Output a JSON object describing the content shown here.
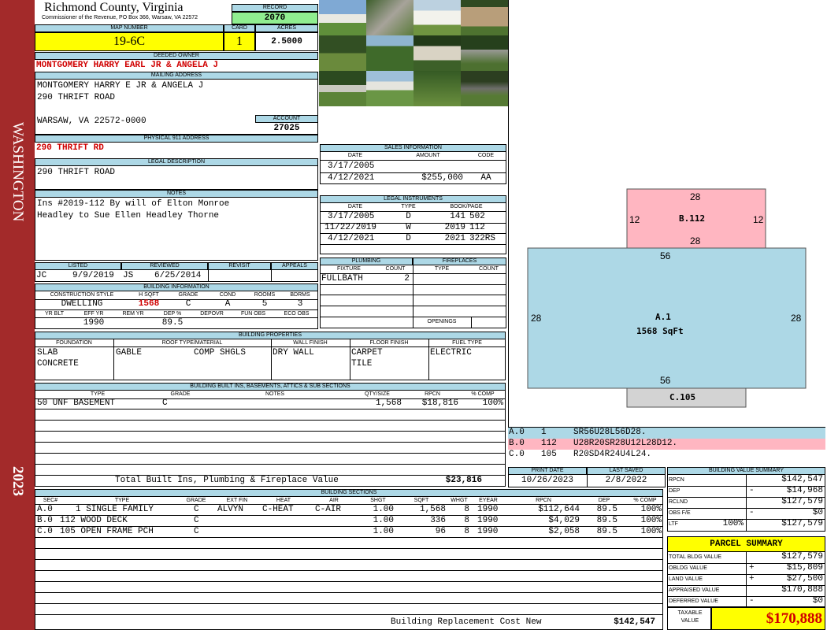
{
  "sidebar": {
    "district": "WASHINGTON",
    "year": "2023"
  },
  "header": {
    "county": "Richmond County, Virginia",
    "commissioner": "Commissioner of the Revenue, PO Box 366, Warsaw, VA 22572",
    "record_label": "RECORD",
    "record": "2070",
    "map_label": "MAP NUMBER",
    "map": "19-6C",
    "card_label": "CARD",
    "card": "1",
    "acres_label": "ACRES",
    "acres": "2.5000"
  },
  "owner": {
    "deeded_label": "DEEDED OWNER",
    "deeded": "MONTGOMERY HARRY EARL JR & ANGELA J",
    "mailing_label": "MAILING ADDRESS",
    "mailing": [
      "MONTGOMERY HARRY E JR & ANGELA J",
      "290 THRIFT ROAD",
      "WARSAW, VA 22572-0000"
    ],
    "account_label": "ACCOUNT",
    "account": "27025",
    "physical_label": "PHYSICAL 911 ADDRESS",
    "physical": "290 THRIFT RD",
    "legal_label": "LEGAL DESCRIPTION",
    "legal": "290 THRIFT ROAD",
    "notes_label": "NOTES",
    "notes": [
      "Ins #2019-112 By will of Elton Monroe",
      "Headley to Sue Ellen Headley Thorne"
    ]
  },
  "review": {
    "listed_label": "LISTED",
    "reviewed_label": "REVIEWED",
    "revisit_label": "REVISIT",
    "appeals_label": "APPEALS",
    "listed_by": "JC",
    "listed_date": "9/9/2019",
    "reviewed_by": "JS",
    "reviewed_date": "6/25/2014"
  },
  "building_info": {
    "label": "BUILDING INFORMATION",
    "headers": [
      "CONSTRUCTION STYLE",
      "H SQFT",
      "GRADE",
      "COND",
      "ROOMS",
      "BDRMS"
    ],
    "values": [
      "DWELLING",
      "1568",
      "C",
      "A",
      "5",
      "3"
    ],
    "headers2": [
      "YR BLT",
      "EFF YR",
      "REM YR",
      "DEP %",
      "DEPOVR",
      "FUN OBS",
      "ECO OBS"
    ],
    "values2": [
      "",
      "1990",
      "",
      "89.5",
      "",
      "",
      ""
    ]
  },
  "properties": {
    "label": "BUILDING PROPERTIES",
    "headers": [
      "FOUNDATION",
      "ROOF TYPE/MATERIAL",
      "WALL FINISH",
      "FLOOR FINISH",
      "FUEL TYPE"
    ],
    "foundation": [
      "SLAB",
      "CONCRETE"
    ],
    "roof_type": "GABLE",
    "roof_material": "COMP SHGLS",
    "wall": "DRY WALL",
    "floor": [
      "CARPET",
      "TILE"
    ],
    "fuel": "ELECTRIC"
  },
  "builtins": {
    "label": "BUILDING BUILT INS, BASEMENTS, ATTICS & SUB SECTIONS",
    "headers": [
      "TYPE",
      "GRADE",
      "NOTES",
      "QTY/SIZE",
      "RPCN",
      "% COMP"
    ],
    "rows": [
      {
        "type": "50 UNF BASEMENT",
        "grade": "C",
        "notes": "",
        "qty": "1,568",
        "rpcn": "$18,816",
        "comp": "100%"
      }
    ],
    "total_label": "Total Built Ins, Plumbing & Fireplace Value",
    "total": "$23,816"
  },
  "sales": {
    "label": "SALES INFORMATION",
    "headers": [
      "DATE",
      "AMOUNT",
      "CODE"
    ],
    "rows": [
      {
        "date": "3/17/2005",
        "amount": "",
        "code": ""
      },
      {
        "date": "4/12/2021",
        "amount": "$255,000",
        "code": "AA"
      }
    ]
  },
  "legal_instruments": {
    "label": "LEGAL INSTRUMENTS",
    "headers": [
      "DATE",
      "TYPE",
      "BOOK/PAGE"
    ],
    "rows": [
      {
        "date": "3/17/2005",
        "type": "D",
        "book": "141",
        "page": "502"
      },
      {
        "date": "11/22/2019",
        "type": "W",
        "book": "2019",
        "page": "112"
      },
      {
        "date": "4/12/2021",
        "type": "D",
        "book": "2021",
        "page": "322RS"
      }
    ]
  },
  "plumbing": {
    "label": "PLUMBING",
    "headers": [
      "FIXTURE",
      "COUNT"
    ],
    "fixture": "FULLBATH",
    "count": "2"
  },
  "fireplaces": {
    "label": "FIREPLACES",
    "headers": [
      "TYPE",
      "COUNT"
    ],
    "openings_label": "OPENINGS"
  },
  "sketch": {
    "b": {
      "label": "B.112",
      "top": "28",
      "bottom": "28",
      "left": "12",
      "right": "12"
    },
    "a": {
      "label": "A.1",
      "area": "1568 SqFt",
      "top": "56",
      "bottom": "56",
      "left": "28",
      "right": "28"
    },
    "c": {
      "label": "C.105"
    },
    "legend": [
      {
        "code": "A.0",
        "num": "1",
        "path": "SR56U28L56D28.",
        "color": "#add8e6"
      },
      {
        "code": "B.0",
        "num": "112",
        "path": "U28R20SR28U12L28D12.",
        "color": "#ffb6c1"
      },
      {
        "code": "C.0",
        "num": "105",
        "path": "R20SD4R24U4L24.",
        "color": "#ffffff"
      }
    ]
  },
  "print": {
    "print_label": "PRINT DATE",
    "print": "10/26/2023",
    "saved_label": "LAST SAVED",
    "saved": "2/8/2022"
  },
  "sections": {
    "label": "BUILDING SECTIONS",
    "headers": [
      "SEC#",
      "TYPE",
      "GRADE",
      "EXT FIN",
      "HEAT",
      "AIR",
      "SHGT",
      "SQFT",
      "WHGT",
      "EYEAR",
      "RPCN",
      "DEP",
      "% COMP"
    ],
    "rows": [
      {
        "sec": "A.0",
        "type": "1 SINGLE FAMILY",
        "grade": "C",
        "ext": "ALVYN",
        "heat": "C-HEAT",
        "air": "C-AIR",
        "shgt": "1.00",
        "sqft": "1,568",
        "whgt": "8",
        "eyear": "1990",
        "rpcn": "$112,644",
        "dep": "89.5",
        "comp": "100%"
      },
      {
        "sec": "B.0",
        "type": "112 WOOD DECK",
        "grade": "C",
        "ext": "",
        "heat": "",
        "air": "",
        "shgt": "1.00",
        "sqft": "336",
        "whgt": "8",
        "eyear": "1990",
        "rpcn": "$4,029",
        "dep": "89.5",
        "comp": "100%"
      },
      {
        "sec": "C.0",
        "type": "105 OPEN FRAME PCH",
        "grade": "C",
        "ext": "",
        "heat": "",
        "air": "",
        "shgt": "1.00",
        "sqft": "96",
        "whgt": "8",
        "eyear": "1990",
        "rpcn": "$2,058",
        "dep": "89.5",
        "comp": "100%"
      }
    ],
    "total_label": "Building Replacement Cost New",
    "total": "$142,547"
  },
  "value_summary": {
    "label": "BUILDING VALUE SUMMARY",
    "rows": [
      {
        "label": "RPCN",
        "sign": "",
        "value": "$142,547"
      },
      {
        "label": "DEP",
        "sign": "-",
        "value": "$14,968"
      },
      {
        "label": "RCLND",
        "sign": "",
        "value": "$127,579"
      },
      {
        "label": "OBS F/E",
        "sign": "-",
        "value": "$0"
      },
      {
        "label": "LTF",
        "pct": "100%",
        "sign": "",
        "value": "$127,579"
      }
    ]
  },
  "parcel": {
    "label": "PARCEL SUMMARY",
    "rows": [
      {
        "label": "TOTAL BLDG VALUE",
        "sign": "",
        "value": "$127,579"
      },
      {
        "label": "OBLDG VALUE",
        "sign": "+",
        "value": "$15,809"
      },
      {
        "label": "LAND VALUE",
        "sign": "+",
        "value": "$27,500"
      },
      {
        "label": "APPRAISED VALUE",
        "sign": "",
        "value": "$170,888"
      },
      {
        "label": "DEFERRED VALUE",
        "sign": "-",
        "value": "$0"
      }
    ],
    "taxable_label": "TAXABLE VALUE",
    "taxable": "$170,888"
  },
  "colors": {
    "sidebar": "#a32a2a",
    "header_blue": "#add8e6",
    "yellow": "#ffff00",
    "green": "#90ee90",
    "pink": "#ffb6c1",
    "red_text": "#d00000"
  }
}
